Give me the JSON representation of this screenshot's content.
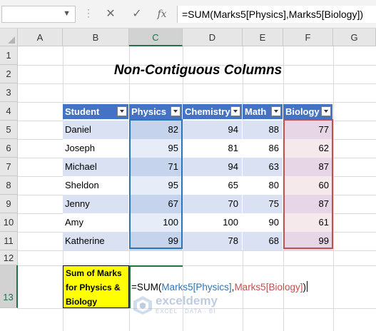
{
  "formula_bar": {
    "name_box": "",
    "cancel_icon": "✕",
    "enter_icon": "✓",
    "fx_label": "fx",
    "formula": "=SUM(Marks5[Physics],Marks5[Biology])"
  },
  "columns": [
    "A",
    "B",
    "C",
    "D",
    "E",
    "F",
    "G"
  ],
  "rows": [
    "1",
    "2",
    "3",
    "4",
    "5",
    "6",
    "7",
    "8",
    "9",
    "10",
    "11",
    "12",
    "13"
  ],
  "sheet": {
    "title": "Non-Contiguous Columns",
    "table": {
      "headers": [
        "Student",
        "Physics",
        "Chemistry",
        "Math",
        "Biology"
      ],
      "rows": [
        [
          "Daniel",
          "82",
          "94",
          "88",
          "77"
        ],
        [
          "Joseph",
          "95",
          "81",
          "86",
          "62"
        ],
        [
          "Michael",
          "71",
          "94",
          "63",
          "87"
        ],
        [
          "Sheldon",
          "95",
          "65",
          "80",
          "60"
        ],
        [
          "Jenny",
          "67",
          "70",
          "75",
          "87"
        ],
        [
          "Amy",
          "100",
          "100",
          "90",
          "61"
        ],
        [
          "Katherine",
          "99",
          "78",
          "68",
          "99"
        ]
      ]
    },
    "sum_label_lines": [
      "Sum of Marks",
      "for Physics &",
      "Biology"
    ],
    "formula_cell": {
      "prefix": "=SUM(",
      "ref1": "Marks5[Physics]",
      "sep": ",",
      "ref2": "Marks5[Biology]",
      "suffix": ")"
    }
  },
  "watermark": {
    "name": "exceldemy",
    "tagline": "EXCEL · DATA · BI"
  },
  "colors": {
    "header_blue": "#4472c4",
    "band_dark": "#d9e1f2",
    "band_light": "#ffffff",
    "physics_dark": "#c5d3ec",
    "physics_light": "#e6edf8",
    "biology_dark": "#e6d6e6",
    "biology_light": "#f6e9ec",
    "ref_blue": "#2e75b6",
    "ref_red": "#c0504d",
    "excel_green": "#217346",
    "yellow": "#ffff00"
  }
}
